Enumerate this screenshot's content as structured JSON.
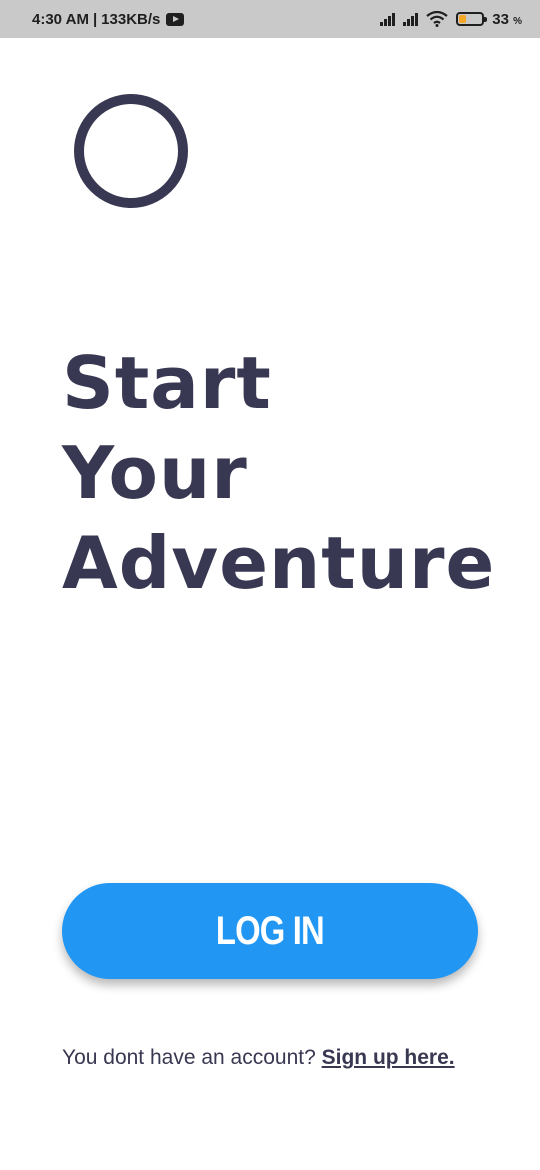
{
  "status_bar": {
    "time": "4:30 AM",
    "separator": "|",
    "net_speed": "133KB/s",
    "battery_percent": "33",
    "battery_unit": "%",
    "battery_level": 0.33,
    "battery_color": "#f5a623"
  },
  "app": {
    "logo_icon": "circle-logo-icon",
    "headline": [
      "Start",
      "Your",
      "Adventure"
    ],
    "login_button": "LOG IN",
    "signup_prompt": "You dont have an account? ",
    "signup_link": "Sign up here."
  },
  "colors": {
    "primary_text": "#393852",
    "accent": "#2196f3",
    "status_bar_bg": "#c9c9c9"
  }
}
